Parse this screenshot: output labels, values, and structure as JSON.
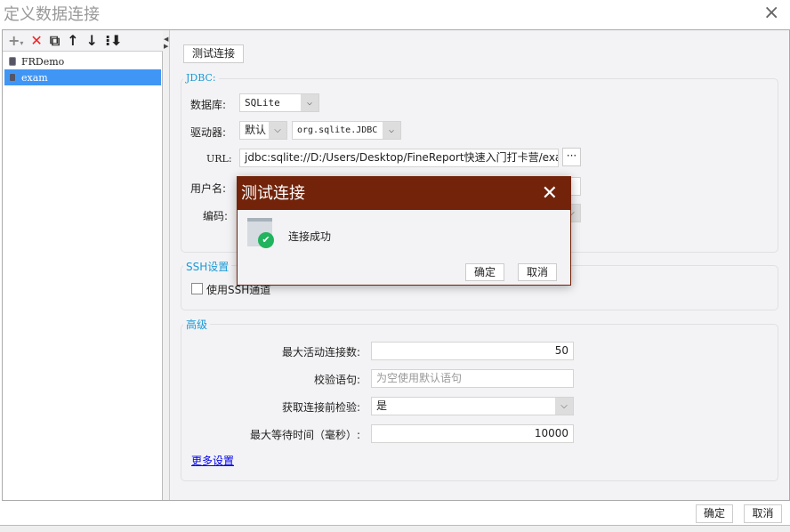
{
  "window": {
    "title": "定义数据连接",
    "close_icon": "×"
  },
  "left": {
    "toolbar": [
      "add-icon",
      "delete-icon",
      "copy-icon",
      "move-up-icon",
      "move-down-icon",
      "sort-icon"
    ],
    "items": [
      {
        "label": "FRDemo",
        "selected": false
      },
      {
        "label": "exam",
        "selected": true
      }
    ]
  },
  "main": {
    "test_button": "测试连接",
    "jdbc": {
      "legend": "JDBC:",
      "db_label": "数据库:",
      "db_value": "SQLite",
      "driver_label": "驱动器:",
      "driver_mode": "默认",
      "driver_value": "org.sqlite.JDBC",
      "url_label": "URL:",
      "url_value": "jdbc:sqlite://D:/Users/Desktop/FineReport快速入门打卡营/exam.d",
      "url_more": "···",
      "user_label": "用户名:",
      "encoding_label": "编码:"
    },
    "ssh": {
      "legend": "SSH设置",
      "use_ssh": "使用SSH通道",
      "checked": false
    },
    "advanced": {
      "legend": "高级",
      "max_active_label": "最大活动连接数:",
      "max_active": "50",
      "validation_label": "校验语句:",
      "validation_placeholder": "为空使用默认语句",
      "test_before_label": "获取连接前检验:",
      "test_before": "是",
      "max_wait_label": "最大等待时间（毫秒）:",
      "max_wait": "10000",
      "more": "更多设置"
    }
  },
  "dialog": {
    "title": "测试连接",
    "message": "连接成功",
    "ok": "确定",
    "cancel": "取消"
  },
  "footer": {
    "ok": "确定",
    "cancel": "取消"
  },
  "colors": {
    "dialog_header": "#72230a",
    "selection": "#4096f5",
    "legend": "#1a9ad6"
  }
}
